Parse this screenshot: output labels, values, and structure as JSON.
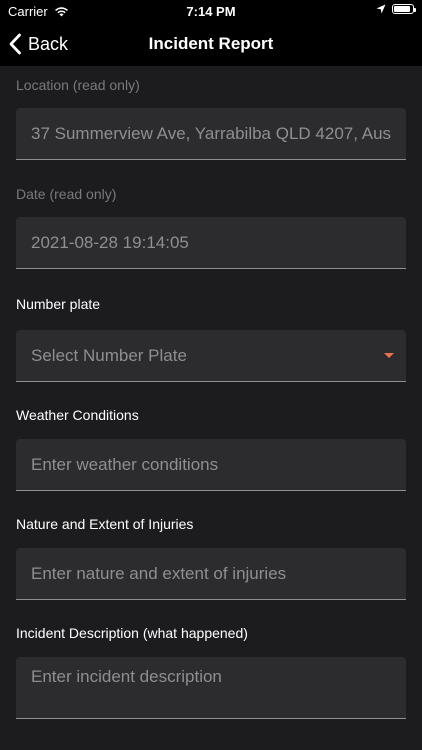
{
  "status_bar": {
    "carrier": "Carrier",
    "time": "7:14 PM",
    "battery_level": 0.9
  },
  "nav": {
    "back_label": "Back",
    "title": "Incident Report"
  },
  "form": {
    "location": {
      "label": "Location (read only)",
      "value": "37 Summerview Ave, Yarrabilba QLD 4207, Aus"
    },
    "date": {
      "label": "Date (read only)",
      "value": "2021-08-28 19:14:05"
    },
    "number_plate": {
      "label": "Number plate",
      "placeholder": "Select Number Plate"
    },
    "weather": {
      "label": "Weather Conditions",
      "placeholder": "Enter weather conditions"
    },
    "injuries": {
      "label": "Nature and Extent of Injuries",
      "placeholder": "Enter nature and extent of injuries"
    },
    "description": {
      "label": "Incident Description (what happened)",
      "placeholder": "Enter incident description"
    }
  },
  "colors": {
    "accent": "#e8734a",
    "field_bg": "#2c2c2e",
    "background": "#1c1c1e"
  }
}
